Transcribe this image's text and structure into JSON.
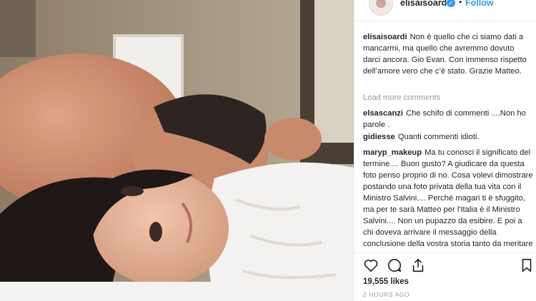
{
  "header": {
    "username": "elisaisoardi",
    "separator": "•",
    "follow_label": "Follow"
  },
  "caption": {
    "username": "elisaisoardi",
    "text": "Non è quello che ci siamo dati a mancarmi, ma quello che avremmo dovuto darci ancora. Gio Evan. Con immenso rispetto dell’amore vero che c’è stato. Grazie Matteo."
  },
  "load_more_label": "Load more comments",
  "comments": [
    {
      "username": "elsascanzi",
      "text": "Che schifo di commenti ....Non ho parole ."
    },
    {
      "username": "gidiesse",
      "text": "Quanti commenti idioti."
    },
    {
      "username": "maryp_makeup",
      "text": "Ma tu conosci il significato del termine.... Buon gusto? A giudicare da questa foto penso proprio di no. Cosa volevi dimostrare postando una foto privata della tua vita con il Ministro Salvini.... Perché magari ti è sfuggito, ma per te sarà Matteo per l'Italia è il Ministro Salvini.... Non un pupazzo da esibire. E poi a chi doveva arrivare il messaggio della conclusione della vostra storia tanto da meritare un"
    }
  ],
  "likes": "19,555 likes",
  "timestamp": "2 HOURS AGO",
  "icons": {
    "like": "heart-icon",
    "comment": "comment-bubble-icon",
    "share": "share-icon",
    "save": "bookmark-icon",
    "verified": "verified-badge-icon"
  },
  "colors": {
    "link_blue": "#3897f0",
    "text": "#262626",
    "muted": "#999999"
  }
}
